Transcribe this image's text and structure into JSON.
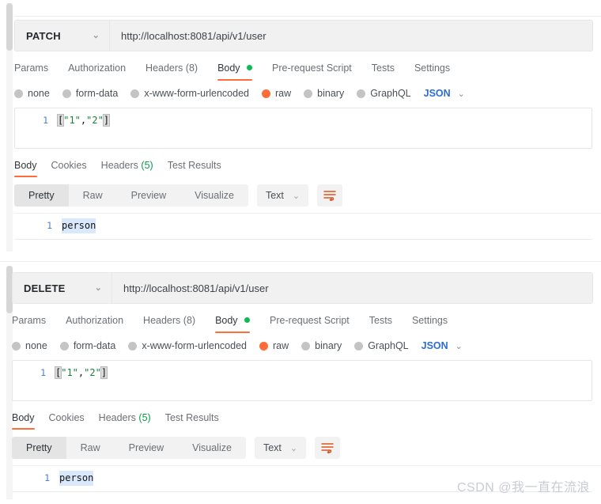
{
  "colors": {
    "accent": "#ff6c37",
    "green_dot": "#0cbb52",
    "headers_count_green": "#0a9a4a",
    "link_blue": "#2d6cd6",
    "radio_grey": "#c4c4c4"
  },
  "panels": [
    {
      "id": "patch-panel",
      "method": "PATCH",
      "method_caret": "⌄",
      "url": "http://localhost:8081/api/v1/user",
      "request_tabs": [
        {
          "label": "Params",
          "active": false,
          "badge": ""
        },
        {
          "label": "Authorization",
          "active": false,
          "badge": ""
        },
        {
          "label": "Headers",
          "active": false,
          "badge": "(8)"
        },
        {
          "label": "Body",
          "active": true,
          "badge": "",
          "dot": "green"
        },
        {
          "label": "Pre-request Script",
          "active": false,
          "badge": ""
        },
        {
          "label": "Tests",
          "active": false,
          "badge": ""
        },
        {
          "label": "Settings",
          "active": false,
          "badge": ""
        }
      ],
      "body_types": [
        {
          "label": "none",
          "selected": false
        },
        {
          "label": "form-data",
          "selected": false
        },
        {
          "label": "x-www-form-urlencoded",
          "selected": false
        },
        {
          "label": "raw",
          "selected": true
        },
        {
          "label": "binary",
          "selected": false
        },
        {
          "label": "GraphQL",
          "selected": false
        }
      ],
      "language": "JSON",
      "language_caret": "⌄",
      "request_body": {
        "line_number": "1",
        "open_bracket": "[",
        "value_1": "\"1\"",
        "comma": ",",
        "value_2": "\"2\"",
        "close_bracket": "]"
      },
      "response_tabs": [
        {
          "label": "Body",
          "active": true,
          "badge": ""
        },
        {
          "label": "Cookies",
          "active": false,
          "badge": ""
        },
        {
          "label": "Headers",
          "active": false,
          "badge": "(5)"
        },
        {
          "label": "Test Results",
          "active": false,
          "badge": ""
        }
      ],
      "view_modes": [
        {
          "label": "Pretty",
          "active": true
        },
        {
          "label": "Raw",
          "active": false
        },
        {
          "label": "Preview",
          "active": false
        },
        {
          "label": "Visualize",
          "active": false
        }
      ],
      "format": "Text",
      "format_caret": "⌄",
      "wrap_icon": "wrap-lines-icon",
      "response_body": {
        "line_number": "1",
        "text": "person"
      }
    },
    {
      "id": "delete-panel",
      "method": "DELETE",
      "method_caret": "⌄",
      "url": "http://localhost:8081/api/v1/user",
      "request_tabs": [
        {
          "label": "Params",
          "active": false,
          "badge": ""
        },
        {
          "label": "Authorization",
          "active": false,
          "badge": ""
        },
        {
          "label": "Headers",
          "active": false,
          "badge": "(8)"
        },
        {
          "label": "Body",
          "active": true,
          "badge": "",
          "dot": "green"
        },
        {
          "label": "Pre-request Script",
          "active": false,
          "badge": ""
        },
        {
          "label": "Tests",
          "active": false,
          "badge": ""
        },
        {
          "label": "Settings",
          "active": false,
          "badge": ""
        }
      ],
      "body_types": [
        {
          "label": "none",
          "selected": false
        },
        {
          "label": "form-data",
          "selected": false
        },
        {
          "label": "x-www-form-urlencoded",
          "selected": false
        },
        {
          "label": "raw",
          "selected": true
        },
        {
          "label": "binary",
          "selected": false
        },
        {
          "label": "GraphQL",
          "selected": false
        }
      ],
      "language": "JSON",
      "language_caret": "⌄",
      "request_body": {
        "line_number": "1",
        "open_bracket": "[",
        "value_1": "\"1\"",
        "comma": ",",
        "value_2": "\"2\"",
        "close_bracket": "]"
      },
      "response_tabs": [
        {
          "label": "Body",
          "active": true,
          "badge": ""
        },
        {
          "label": "Cookies",
          "active": false,
          "badge": ""
        },
        {
          "label": "Headers",
          "active": false,
          "badge": "(5)"
        },
        {
          "label": "Test Results",
          "active": false,
          "badge": ""
        }
      ],
      "view_modes": [
        {
          "label": "Pretty",
          "active": true
        },
        {
          "label": "Raw",
          "active": false
        },
        {
          "label": "Preview",
          "active": false
        },
        {
          "label": "Visualize",
          "active": false
        }
      ],
      "format": "Text",
      "format_caret": "⌄",
      "wrap_icon": "wrap-lines-icon",
      "response_body": {
        "line_number": "1",
        "text": "person"
      }
    }
  ],
  "watermark": "CSDN @我一直在流浪"
}
